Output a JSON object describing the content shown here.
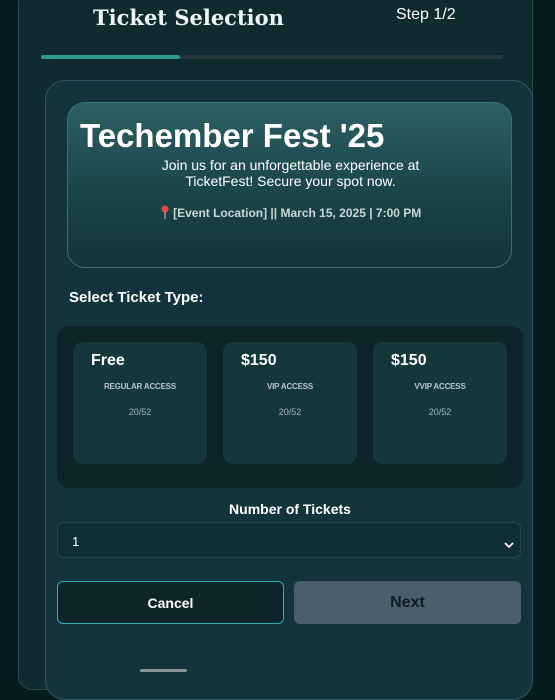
{
  "header": {
    "title": "Ticket Selection",
    "step": "Step 1/2",
    "progress_fraction": 0.3
  },
  "event": {
    "title": "Techember Fest '25",
    "description": "Join us for an unforgettable experience at TicketFest! Secure your spot now.",
    "meta": "[Event Location] || March 15, 2025 | 7:00 PM",
    "location_icon": "map-pin-icon"
  },
  "ticket_section": {
    "label": "Select Ticket Type:",
    "options": [
      {
        "price": "Free",
        "type": "REGULAR ACCESS",
        "availability": "20/52"
      },
      {
        "price": "$150",
        "type": "VIP ACCESS",
        "availability": "20/52"
      },
      {
        "price": "$150",
        "type": "VVIP ACCESS",
        "availability": "20/52"
      }
    ]
  },
  "quantity": {
    "label": "Number of Tickets",
    "selected": "1"
  },
  "actions": {
    "cancel_label": "Cancel",
    "next_label": "Next"
  },
  "colors": {
    "accent": "#2a9d8f",
    "cancel_border": "#2ab0b8",
    "next_bg": "#4c5d6c"
  }
}
